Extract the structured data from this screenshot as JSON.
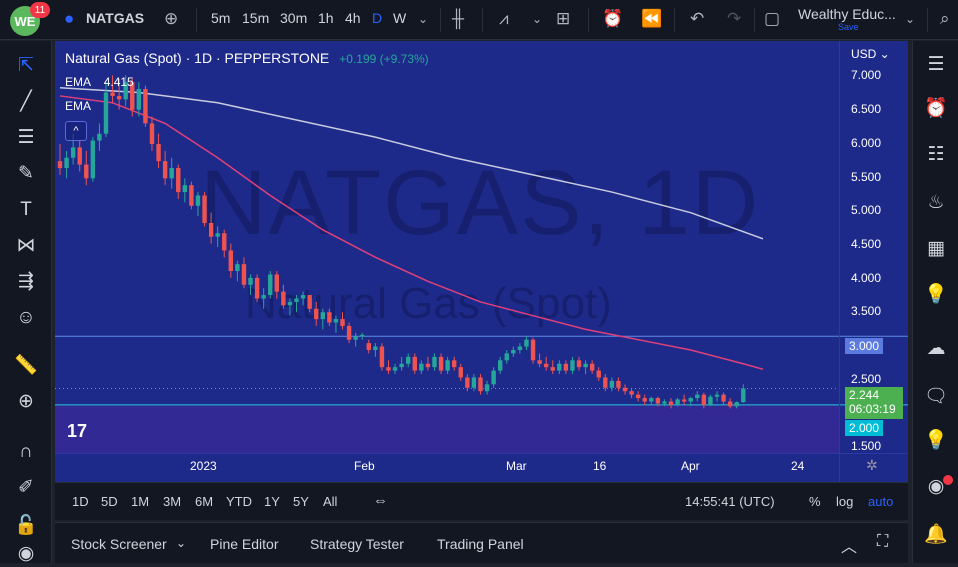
{
  "topbar": {
    "notifications": "11",
    "symbol": "NATGAS",
    "intervals": [
      "5m",
      "15m",
      "30m",
      "1h",
      "4h",
      "D",
      "W"
    ],
    "active_interval": "D",
    "layout_name": "Wealthy Educ...",
    "save_label": "Save",
    "logo_text": "WE"
  },
  "legend": {
    "title": "Natural Gas (Spot) · 1D · PEPPERSTONE",
    "change": "+0.199 (+9.73%)",
    "ema1_label": "EMA",
    "ema1_value": "4.415",
    "ema2_label": "EMA"
  },
  "watermark": {
    "symbol": "NATGAS, 1D",
    "name": "Natural Gas (Spot)"
  },
  "price_axis": {
    "currency": "USD",
    "labels": [
      "7.000",
      "6.500",
      "6.000",
      "5.500",
      "5.000",
      "4.500",
      "4.000",
      "3.500",
      "2.500",
      "1.500"
    ],
    "line_300": "3.000",
    "line_200": "2.000",
    "current_price": "2.244",
    "countdown": "06:03:19"
  },
  "time_axis": {
    "labels": [
      "2023",
      "Feb",
      "Mar",
      "16",
      "Apr",
      "24"
    ]
  },
  "bottombar": {
    "ranges": [
      "1D",
      "5D",
      "1M",
      "3M",
      "6M",
      "YTD",
      "1Y",
      "5Y",
      "All"
    ],
    "clock": "14:55:41 (UTC)",
    "pct": "%",
    "log": "log",
    "auto": "auto"
  },
  "panelbar": {
    "tabs": [
      "Stock Screener",
      "Pine Editor",
      "Strategy Tester",
      "Trading Panel"
    ]
  },
  "colors": {
    "chart_bg": "#1e2a8a",
    "up": "#26a69a",
    "down": "#ef5350",
    "ema_fast": "#e0407a",
    "ema_slow": "#c7cbe0",
    "level_line": "#4f8ff0",
    "price_tag": "#4caf50",
    "level_tag": "#5b7be0",
    "level_tag2": "#00bcd4"
  },
  "chart_data": {
    "type": "candlestick",
    "ylim": [
      1.3,
      7.3
    ],
    "horizontal_lines": [
      3.0,
      2.0
    ],
    "candles": [
      [
        5.55,
        5.8,
        5.35,
        5.45
      ],
      [
        5.45,
        5.7,
        5.3,
        5.6
      ],
      [
        5.6,
        5.95,
        5.5,
        5.75
      ],
      [
        5.75,
        5.85,
        5.4,
        5.5
      ],
      [
        5.5,
        5.7,
        5.2,
        5.3
      ],
      [
        5.3,
        5.9,
        5.25,
        5.85
      ],
      [
        5.85,
        6.1,
        5.7,
        5.95
      ],
      [
        5.95,
        6.7,
        5.9,
        6.55
      ],
      [
        6.55,
        6.8,
        6.4,
        6.5
      ],
      [
        6.5,
        6.75,
        6.3,
        6.45
      ],
      [
        6.45,
        6.8,
        6.35,
        6.7
      ],
      [
        6.7,
        6.75,
        6.2,
        6.3
      ],
      [
        6.3,
        6.7,
        6.2,
        6.6
      ],
      [
        6.6,
        6.65,
        6.05,
        6.1
      ],
      [
        6.1,
        6.2,
        5.7,
        5.8
      ],
      [
        5.8,
        5.95,
        5.45,
        5.55
      ],
      [
        5.55,
        5.7,
        5.2,
        5.3
      ],
      [
        5.3,
        5.6,
        5.15,
        5.45
      ],
      [
        5.45,
        5.5,
        5.0,
        5.1
      ],
      [
        5.1,
        5.3,
        4.95,
        5.2
      ],
      [
        5.2,
        5.25,
        4.85,
        4.9
      ],
      [
        4.9,
        5.1,
        4.75,
        5.05
      ],
      [
        5.05,
        5.1,
        4.6,
        4.65
      ],
      [
        4.65,
        4.8,
        4.35,
        4.45
      ],
      [
        4.45,
        4.6,
        4.3,
        4.5
      ],
      [
        4.5,
        4.55,
        4.15,
        4.25
      ],
      [
        4.25,
        4.35,
        3.85,
        3.95
      ],
      [
        3.95,
        4.1,
        3.8,
        4.05
      ],
      [
        4.05,
        4.15,
        3.7,
        3.75
      ],
      [
        3.75,
        3.9,
        3.6,
        3.85
      ],
      [
        3.85,
        3.9,
        3.5,
        3.55
      ],
      [
        3.55,
        3.7,
        3.4,
        3.6
      ],
      [
        3.6,
        3.95,
        3.55,
        3.9
      ],
      [
        3.9,
        3.95,
        3.55,
        3.65
      ],
      [
        3.65,
        3.75,
        3.4,
        3.45
      ],
      [
        3.45,
        3.55,
        3.3,
        3.5
      ],
      [
        3.5,
        3.6,
        3.35,
        3.55
      ],
      [
        3.55,
        3.65,
        3.45,
        3.6
      ],
      [
        3.6,
        3.6,
        3.35,
        3.4
      ],
      [
        3.4,
        3.5,
        3.15,
        3.25
      ],
      [
        3.25,
        3.4,
        3.1,
        3.35
      ],
      [
        3.35,
        3.4,
        3.15,
        3.2
      ],
      [
        3.2,
        3.3,
        3.05,
        3.25
      ],
      [
        3.25,
        3.35,
        3.1,
        3.15
      ],
      [
        3.15,
        3.2,
        2.9,
        2.95
      ],
      [
        2.95,
        3.05,
        2.85,
        3.0
      ],
      [
        3.0,
        3.05,
        2.95,
        3.02
      ],
      [
        2.9,
        2.95,
        2.75,
        2.8
      ],
      [
        2.8,
        2.9,
        2.7,
        2.85
      ],
      [
        2.85,
        2.9,
        2.5,
        2.55
      ],
      [
        2.55,
        2.65,
        2.45,
        2.5
      ],
      [
        2.5,
        2.6,
        2.45,
        2.55
      ],
      [
        2.55,
        2.7,
        2.5,
        2.6
      ],
      [
        2.6,
        2.75,
        2.55,
        2.7
      ],
      [
        2.7,
        2.75,
        2.45,
        2.5
      ],
      [
        2.5,
        2.65,
        2.45,
        2.6
      ],
      [
        2.6,
        2.7,
        2.5,
        2.55
      ],
      [
        2.55,
        2.75,
        2.5,
        2.7
      ],
      [
        2.7,
        2.75,
        2.45,
        2.5
      ],
      [
        2.5,
        2.7,
        2.45,
        2.65
      ],
      [
        2.65,
        2.7,
        2.5,
        2.55
      ],
      [
        2.55,
        2.6,
        2.35,
        2.4
      ],
      [
        2.4,
        2.45,
        2.2,
        2.25
      ],
      [
        2.25,
        2.45,
        2.2,
        2.4
      ],
      [
        2.4,
        2.45,
        2.15,
        2.2
      ],
      [
        2.2,
        2.35,
        2.15,
        2.3
      ],
      [
        2.3,
        2.55,
        2.25,
        2.5
      ],
      [
        2.5,
        2.7,
        2.45,
        2.65
      ],
      [
        2.65,
        2.8,
        2.6,
        2.75
      ],
      [
        2.75,
        2.85,
        2.7,
        2.8
      ],
      [
        2.8,
        2.9,
        2.75,
        2.85
      ],
      [
        2.85,
        3.0,
        2.8,
        2.95
      ],
      [
        2.95,
        2.98,
        2.6,
        2.65
      ],
      [
        2.65,
        2.75,
        2.55,
        2.6
      ],
      [
        2.6,
        2.7,
        2.5,
        2.55
      ],
      [
        2.55,
        2.65,
        2.45,
        2.5
      ],
      [
        2.5,
        2.65,
        2.45,
        2.6
      ],
      [
        2.6,
        2.65,
        2.45,
        2.5
      ],
      [
        2.5,
        2.7,
        2.45,
        2.65
      ],
      [
        2.65,
        2.7,
        2.5,
        2.55
      ],
      [
        2.55,
        2.65,
        2.45,
        2.6
      ],
      [
        2.6,
        2.65,
        2.45,
        2.5
      ],
      [
        2.5,
        2.55,
        2.35,
        2.4
      ],
      [
        2.4,
        2.45,
        2.2,
        2.25
      ],
      [
        2.25,
        2.4,
        2.2,
        2.35
      ],
      [
        2.35,
        2.4,
        2.2,
        2.25
      ],
      [
        2.25,
        2.3,
        2.15,
        2.2
      ],
      [
        2.2,
        2.25,
        2.1,
        2.15
      ],
      [
        2.15,
        2.2,
        2.05,
        2.1
      ],
      [
        2.1,
        2.15,
        2.0,
        2.05
      ],
      [
        2.05,
        2.12,
        2.0,
        2.1
      ],
      [
        2.1,
        2.12,
        1.98,
        2.02
      ],
      [
        2.02,
        2.08,
        1.98,
        2.05
      ],
      [
        2.05,
        2.1,
        1.95,
        2.0
      ],
      [
        2.0,
        2.1,
        1.98,
        2.08
      ],
      [
        2.08,
        2.15,
        2.0,
        2.05
      ],
      [
        2.05,
        2.12,
        1.98,
        2.1
      ],
      [
        2.1,
        2.2,
        2.05,
        2.15
      ],
      [
        2.15,
        2.18,
        1.95,
        2.0
      ],
      [
        2.0,
        2.15,
        1.98,
        2.12
      ],
      [
        2.12,
        2.2,
        2.05,
        2.15
      ],
      [
        2.15,
        2.18,
        2.0,
        2.05
      ],
      [
        2.05,
        2.1,
        1.95,
        1.98
      ],
      [
        1.98,
        2.05,
        1.95,
        2.04
      ],
      [
        2.04,
        2.3,
        2.03,
        2.24
      ]
    ],
    "ema_fast": [
      [
        0,
        6.5
      ],
      [
        8,
        6.4
      ],
      [
        16,
        6.1
      ],
      [
        24,
        5.6
      ],
      [
        32,
        5.05
      ],
      [
        40,
        4.55
      ],
      [
        48,
        4.15
      ],
      [
        56,
        3.8
      ],
      [
        64,
        3.5
      ],
      [
        72,
        3.3
      ],
      [
        80,
        3.1
      ],
      [
        88,
        2.95
      ],
      [
        96,
        2.8
      ],
      [
        104,
        2.6
      ],
      [
        107,
        2.52
      ]
    ],
    "ema_slow": [
      [
        0,
        6.62
      ],
      [
        12,
        6.55
      ],
      [
        24,
        6.4
      ],
      [
        36,
        6.15
      ],
      [
        48,
        5.9
      ],
      [
        60,
        5.6
      ],
      [
        72,
        5.35
      ],
      [
        84,
        5.1
      ],
      [
        96,
        4.8
      ],
      [
        107,
        4.42
      ]
    ]
  }
}
